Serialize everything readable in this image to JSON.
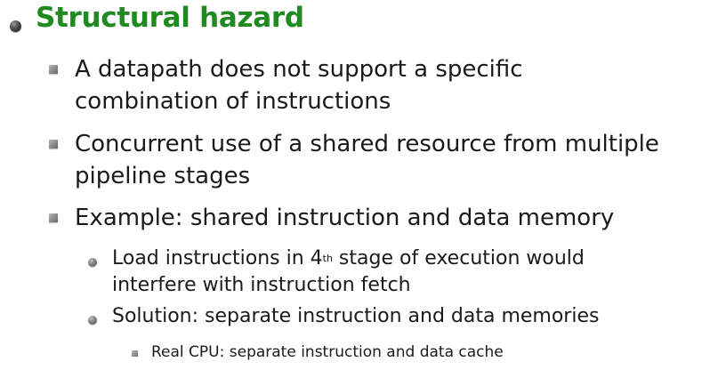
{
  "slide": {
    "heading": "Structural hazard",
    "points": [
      {
        "lines": [
          "A datapath does not support a specific",
          "combination of instructions"
        ]
      },
      {
        "lines": [
          "Concurrent use of a shared resource from multiple",
          "pipeline stages"
        ]
      },
      {
        "lines": [
          "Example: shared instruction and data memory"
        ]
      }
    ],
    "subpoints": [
      {
        "line1_before": "Load  instructions in 4",
        "line1_sup": "th",
        "line1_after": " stage of execution would",
        "line2": "interfere with instruction fetch"
      },
      {
        "line1": "Solution: separate instruction and data memories"
      }
    ],
    "subsubpoints": [
      {
        "line1": "Real CPU: separate instruction and data cache"
      }
    ]
  },
  "colors": {
    "heading": "#1f8a1f",
    "body_text": "#1a1a1a"
  },
  "icons": {
    "level0": "round-bullet-icon",
    "level1": "square-bullet-icon",
    "level2": "round-bullet-icon",
    "level3": "square-bullet-icon"
  }
}
